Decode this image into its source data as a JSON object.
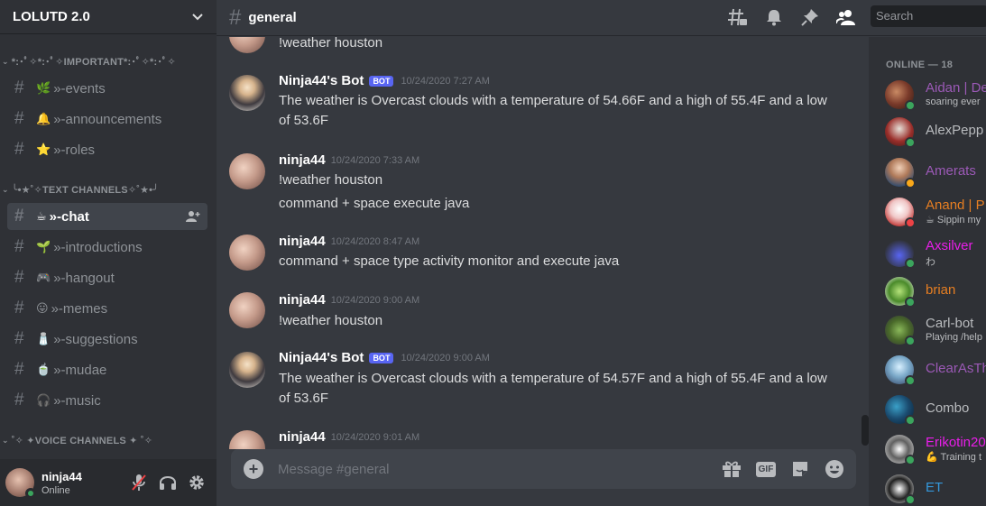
{
  "server": {
    "name": "LOLUTD 2.0"
  },
  "categories": [
    {
      "label": "*:･ﾟ✧*:･ﾟ✧IMPORTANT*:･ﾟ✧*:･ﾟ✧"
    },
    {
      "label": "╰•★˚✧TEXT CHANNELS✧˚★•╯"
    },
    {
      "label": "˚✧ ✦VOICE CHANNELS ✦ ˚✧"
    }
  ],
  "channels": [
    {
      "emoji": "🌿",
      "name": "»-events"
    },
    {
      "emoji": "🔔",
      "name": "»-announcements"
    },
    {
      "emoji": "⭐",
      "name": "»-roles"
    },
    {
      "emoji": "☕",
      "name": "»-chat"
    },
    {
      "emoji": "🌱",
      "name": "»-introductions"
    },
    {
      "emoji": "🎮",
      "name": "»-hangout"
    },
    {
      "emoji": "😛",
      "name": "»-memes"
    },
    {
      "emoji": "🧂",
      "name": "»-suggestions"
    },
    {
      "emoji": "🍵",
      "name": "»-mudae"
    },
    {
      "emoji": "🎧",
      "name": "»-music"
    }
  ],
  "user": {
    "name": "ninja44",
    "status": "Online"
  },
  "header": {
    "hash": "#",
    "channel": "general",
    "search_placeholder": "Search"
  },
  "messages": [
    {
      "text": "!weather houston"
    },
    {
      "author": "Ninja44's Bot",
      "bot": "BOT",
      "time": "10/24/2020 7:27 AM",
      "text": "The weather is Overcast clouds with a temperature of 54.66F and a high of 55.4F and a low of 53.6F"
    },
    {
      "author": "ninja44",
      "time": "10/24/2020 7:33 AM",
      "text": "!weather houston"
    },
    {
      "text": "command + space execute java"
    },
    {
      "author": "ninja44",
      "time": "10/24/2020 8:47 AM",
      "text": "command + space type activity monitor and execute java"
    },
    {
      "author": "ninja44",
      "time": "10/24/2020 9:00 AM",
      "text": "!weather houston"
    },
    {
      "author": "Ninja44's Bot",
      "bot": "BOT",
      "time": "10/24/2020 9:00 AM",
      "text": "The weather is Overcast clouds with a temperature of 54.57F and a high of 55.4F and a low of 53.6F"
    },
    {
      "author": "ninja44",
      "time": "10/24/2020 9:01 AM"
    }
  ],
  "composer": {
    "placeholder": "Message #general",
    "gif_label": "GIF"
  },
  "members": {
    "header": "ONLINE — 18",
    "list": [
      {
        "name": "Aidan | De",
        "sub": "soaring ever",
        "color": "#9b59b6",
        "status": "online"
      },
      {
        "name": "AlexPepp",
        "color": "#b9bbbe",
        "status": "online"
      },
      {
        "name": "Amerats",
        "color": "#9b59b6",
        "status": "idle"
      },
      {
        "name": "Anand | P",
        "sub": "☕ Sippin my",
        "color": "#e67e22",
        "status": "dnd"
      },
      {
        "name": "Axsilver",
        "sub": "わ",
        "color": "#e91ee9",
        "status": "online"
      },
      {
        "name": "brian",
        "color": "#e67e22",
        "status": "online"
      },
      {
        "name": "Carl-bot",
        "sub": "Playing /help",
        "color": "#b9bbbe",
        "status": "online"
      },
      {
        "name": "ClearAsTh",
        "color": "#9b59b6",
        "status": "online"
      },
      {
        "name": "Combo",
        "color": "#b9bbbe",
        "status": "online"
      },
      {
        "name": "Erikotin20",
        "sub": "💪 Training t",
        "color": "#e91ee9",
        "status": "online"
      },
      {
        "name": "ET",
        "color": "#3498db",
        "status": "online"
      }
    ]
  }
}
